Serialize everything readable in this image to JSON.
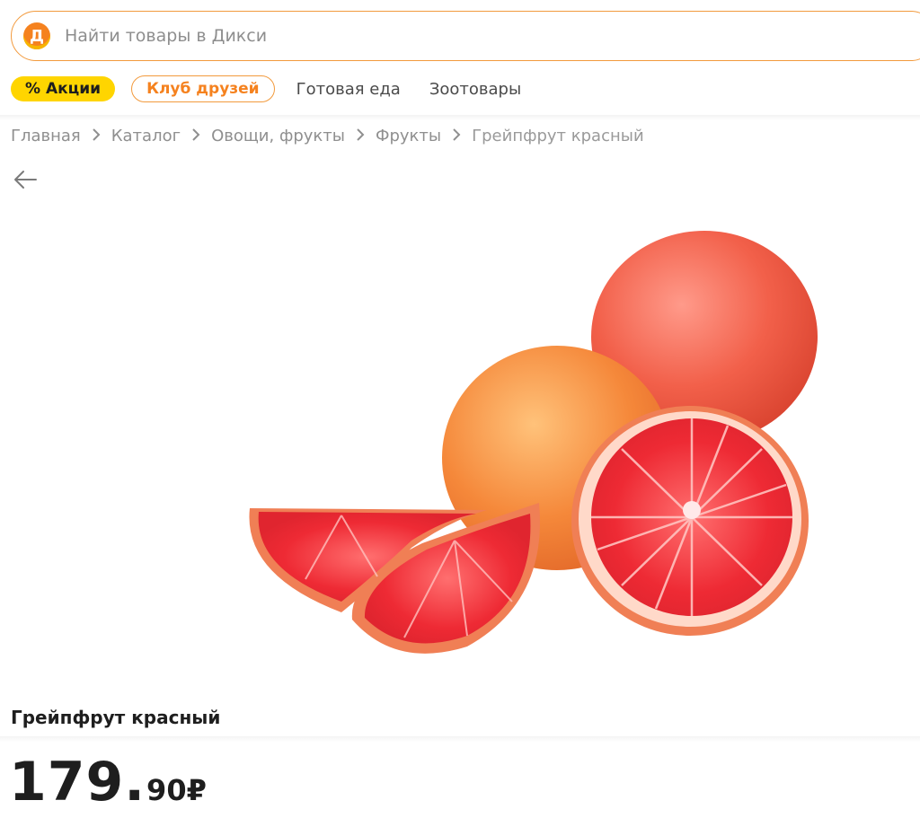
{
  "search": {
    "logo_letter": "Д",
    "placeholder": "Найти товары в Дикси"
  },
  "nav": {
    "promo_label": "% Акции",
    "club_label": "Клуб друзей",
    "links": [
      "Готовая еда",
      "Зоотовары"
    ]
  },
  "breadcrumb": [
    "Главная",
    "Каталог",
    "Овощи, фрукты",
    "Фрукты",
    "Грейпфрут красный"
  ],
  "product": {
    "title": "Грейпфрут красный",
    "price_rubles": "179",
    "price_dot": ".",
    "price_kopecks": "90",
    "currency": "₽"
  },
  "colors": {
    "brand_orange": "#f5821f",
    "promo_yellow": "#ffd500",
    "outline_orange": "#f29a3d"
  },
  "icons": {
    "back": "arrow-left-icon",
    "separator": "chevron-right-icon"
  }
}
